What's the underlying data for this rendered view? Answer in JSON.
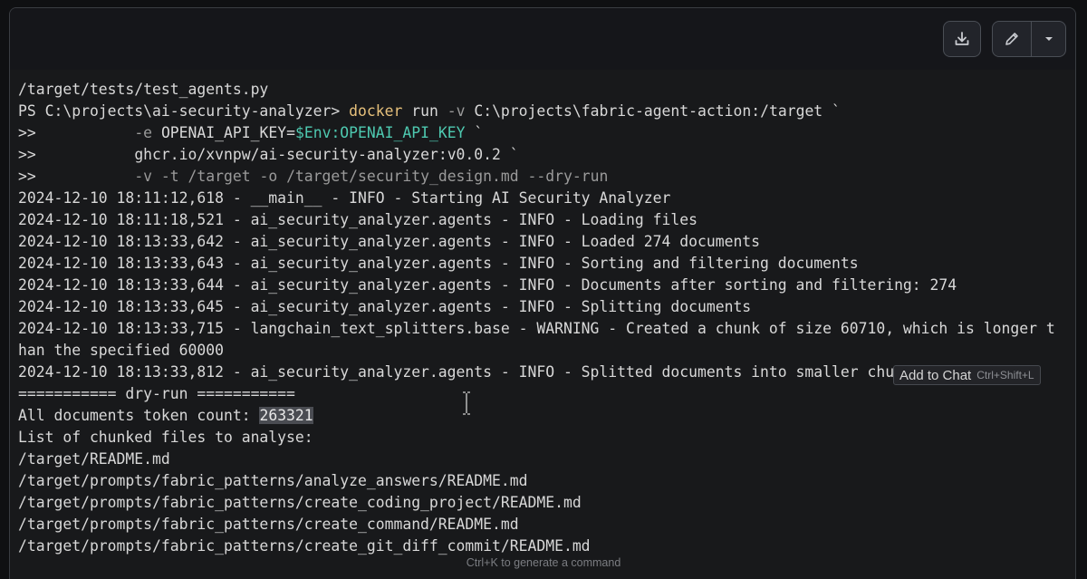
{
  "colors": {
    "background": "#18191b",
    "command": "#e6c07b",
    "env_var": "#4ec9b0",
    "flag": "#9a9a9a",
    "text": "#d8d8d8"
  },
  "toolbar": {
    "download_icon": "download-icon",
    "edit_icon": "pencil-icon",
    "menu_icon": "chevron-down-icon"
  },
  "terminal": {
    "lines": [
      "/target/tests/test_agents.py",
      "PS C:\\projects\\ai-security-analyzer>",
      ">>",
      ">>",
      ">>",
      "2024-12-10 18:11:12,618 - __main__ - INFO - Starting AI Security Analyzer",
      "2024-12-10 18:11:18,521 - ai_security_analyzer.agents - INFO - Loading files",
      "2024-12-10 18:13:33,642 - ai_security_analyzer.agents - INFO - Loaded 274 documents",
      "2024-12-10 18:13:33,643 - ai_security_analyzer.agents - INFO - Sorting and filtering documents",
      "2024-12-10 18:13:33,644 - ai_security_analyzer.agents - INFO - Documents after sorting and filtering: 274",
      "2024-12-10 18:13:33,645 - ai_security_analyzer.agents - INFO - Splitting documents",
      "2024-12-10 18:13:33,715 - langchain_text_splitters.base - WARNING - Created a chunk of size 60710, which is longer t",
      "han the specified 60000",
      "2024-12-10 18:13:33,812 - ai_security_analyzer.agents - INFO - Splitted documents into smaller chunks: 233",
      "=========== dry-run ===========",
      "All documents token count:",
      "List of chunked files to analyse:",
      "/target/README.md",
      "/target/prompts/fabric_patterns/analyze_answers/README.md",
      "/target/prompts/fabric_patterns/create_coding_project/README.md",
      "/target/prompts/fabric_patterns/create_command/README.md",
      "/target/prompts/fabric_patterns/create_git_diff_commit/README.md"
    ],
    "cmd1": {
      "cmd": "docker",
      "run": "run",
      "flag": "-v",
      "arg": "C:\\projects\\fabric-agent-action:/target `"
    },
    "cmd2": {
      "flag": "-e",
      "prefix": "OPENAI_API_KEY=",
      "var": "$Env:OPENAI_API_KEY",
      "tail": " `"
    },
    "cmd3": {
      "image": "ghcr.io/xvnpw/ai-security-analyzer:v0.0.2 `"
    },
    "cmd4": {
      "args": "-v -t /target -o /target/security_design.md --dry-run"
    },
    "token_count": "263321"
  },
  "tooltip": {
    "label": "Add to Chat",
    "shortcut": "Ctrl+Shift+L"
  },
  "footer": {
    "hint": "Ctrl+K to generate a command"
  }
}
